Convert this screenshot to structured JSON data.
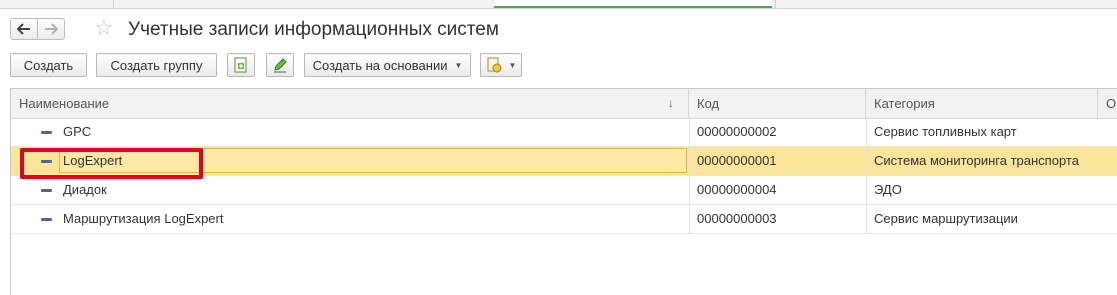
{
  "window": {
    "title": "Учетные записи информационных систем",
    "nav_back_icon": "arrow-left-icon",
    "nav_forward_icon": "arrow-right-icon",
    "favorite_icon": "star-icon"
  },
  "toolbar": {
    "create_label": "Создать",
    "create_group_label": "Создать группу",
    "copy_icon": "copy-icon",
    "edit_icon": "edit-icon",
    "create_basis_label": "Создать на основании",
    "report_icon": "report-icon"
  },
  "table": {
    "columns": [
      "Наименование",
      "Код",
      "Категория",
      "О"
    ],
    "sort_indicator": "↓",
    "rows": [
      {
        "name": "GPC",
        "code": "00000000002",
        "category": "Сервис топливных карт",
        "selected": false
      },
      {
        "name": "LogExpert",
        "code": "00000000001",
        "category": "Система мониторинга транспорта",
        "selected": true
      },
      {
        "name": "Диадок",
        "code": "00000000004",
        "category": "ЭДО",
        "selected": false
      },
      {
        "name": "Маршрутизация LogExpert",
        "code": "00000000003",
        "category": "Сервис маршрутизации",
        "selected": false
      }
    ]
  },
  "colors": {
    "selection": "#fbe59a",
    "highlight_annotation": "#e3001b",
    "active_tab": "#4fa64f"
  }
}
